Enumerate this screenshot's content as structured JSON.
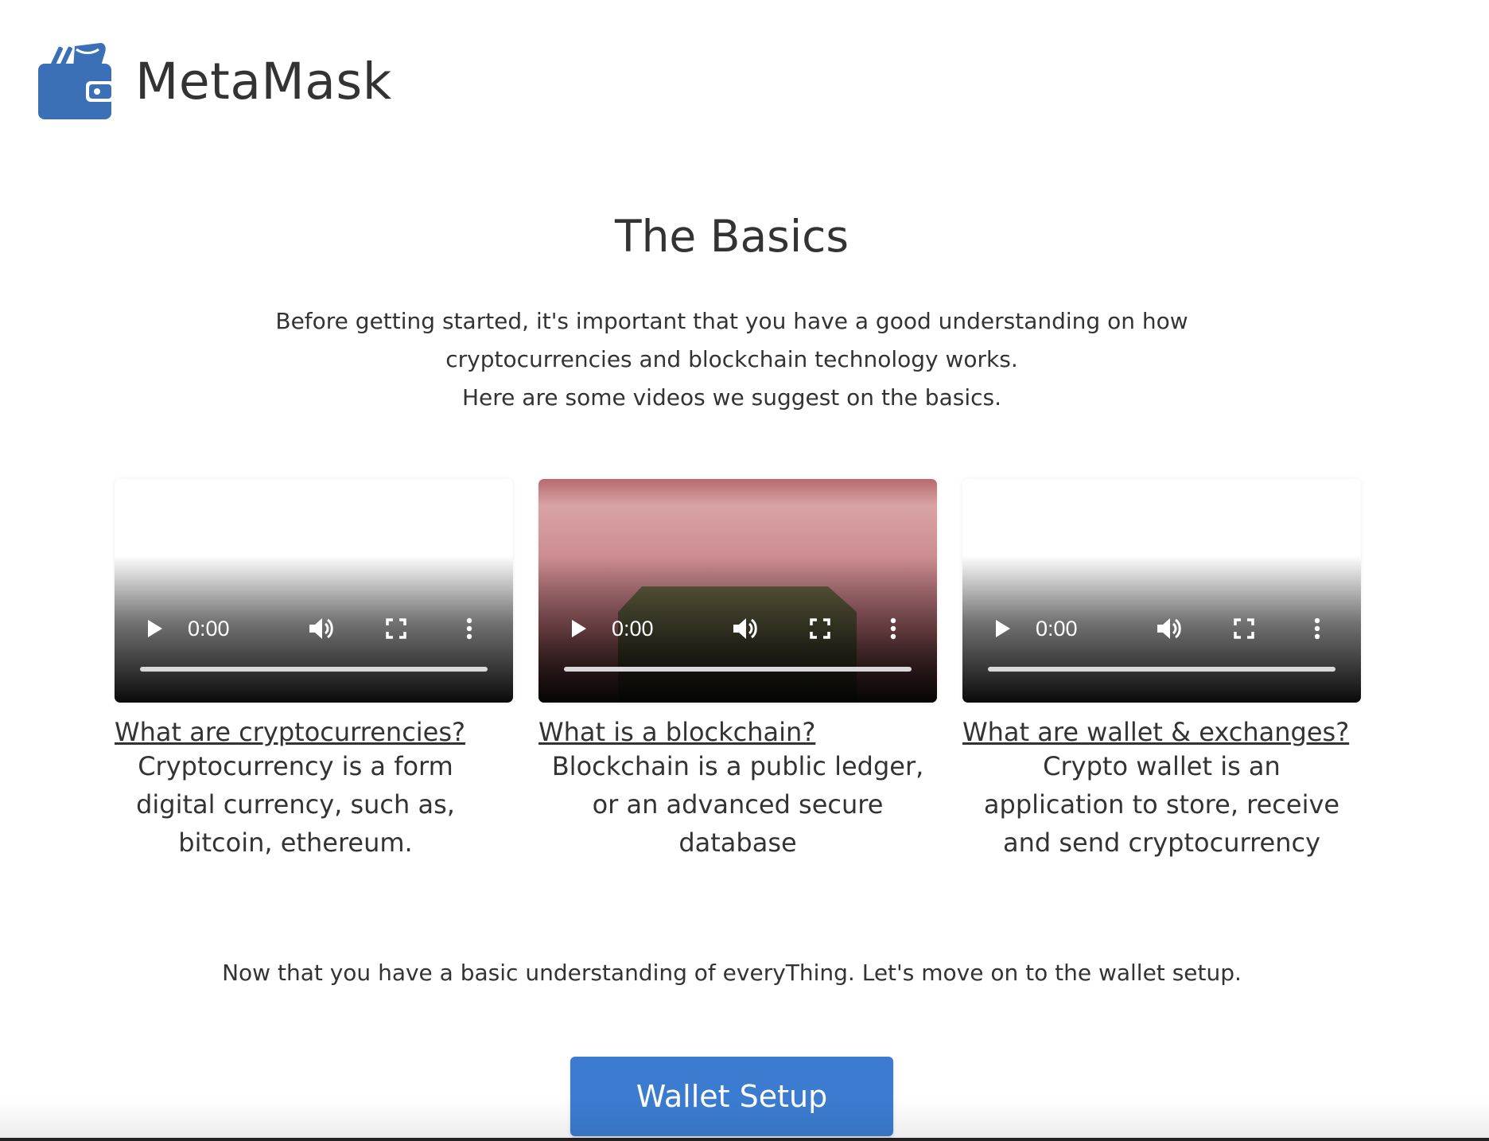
{
  "header": {
    "brand": "MetaMask",
    "logo_icon": "wallet-icon",
    "brand_color": "#3b6fb6"
  },
  "main": {
    "title": "The Basics",
    "intro_lines": [
      "Before getting started, it's important that you have a good understanding on how",
      "cryptocurrencies and blockchain technology works.",
      "Here are some videos we suggest on the basics."
    ],
    "videos": [
      {
        "link": "What are cryptocurrencies?",
        "time": "0:00",
        "progress": 0,
        "description_lines": [
          "Cryptocurrency is a form",
          "digital currency, such as,",
          "bitcoin, ethereum."
        ]
      },
      {
        "link": "What is a blockchain?",
        "time": "0:00",
        "progress": 0,
        "description_lines": [
          "Blockchain is a public ledger,",
          "or an advanced secure",
          "database"
        ]
      },
      {
        "link": "What are wallet & exchanges?",
        "time": "0:00",
        "progress": 0,
        "description_lines": [
          "Crypto wallet is an",
          "application to store, receive",
          "and send cryptocurrency"
        ]
      }
    ],
    "video_control_icons": [
      "play-icon",
      "volume-icon",
      "fullscreen-icon",
      "more-options-icon"
    ],
    "outro": "Now that you have a basic understanding of everyThing. Let's move on to the wallet setup.",
    "cta_label": "Wallet Setup",
    "cta_color": "#3b7cd0"
  }
}
